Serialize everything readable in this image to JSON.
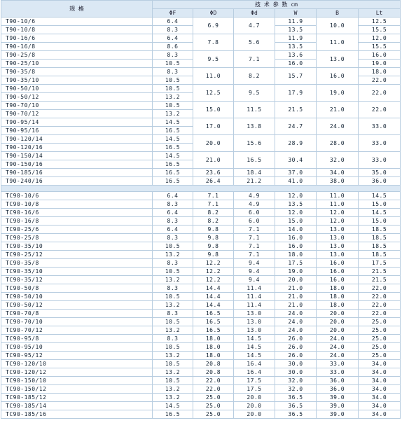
{
  "header": {
    "spec": "规   格",
    "group": "技   术   参   数  cm",
    "cols": [
      "ΦF",
      "ΦD",
      "Φd",
      "W",
      "B",
      "Lt"
    ]
  },
  "rows_t": [
    [
      "T90-10/6",
      "6.4",
      "6.9",
      "4.7",
      "11.9",
      "10.0",
      "12.5"
    ],
    [
      "T90-10/8",
      "8.3",
      null,
      null,
      "13.5",
      null,
      "15.5"
    ],
    [
      "T90-16/6",
      "6.4",
      "7.8",
      "5.6",
      "11.9",
      "11.0",
      "12.0"
    ],
    [
      "T90-16/8",
      "8.6",
      null,
      null,
      "13.5",
      null,
      "15.5"
    ],
    [
      "T90-25/8",
      "8.3",
      "9.5",
      "7.1",
      "13.6",
      "13.0",
      "16.0"
    ],
    [
      "T90-25/10",
      "10.5",
      null,
      null,
      "16.0",
      null,
      "19.0"
    ],
    [
      "T90-35/8",
      "8.3",
      "11.0",
      "8.2",
      "15.7",
      "16.0",
      "18.0"
    ],
    [
      "T90-35/10",
      "10.5",
      null,
      null,
      null,
      null,
      "22.0"
    ],
    [
      "T90-50/10",
      "10.5",
      "12.5",
      "9.5",
      "17.9",
      "19.0",
      "22.0"
    ],
    [
      "T90-50/12",
      "13.2",
      null,
      null,
      null,
      null,
      null
    ],
    [
      "T90-70/10",
      "10.5",
      "15.0",
      "11.5",
      "21.5",
      "21.0",
      "22.0"
    ],
    [
      "T90-70/12",
      "13.2",
      null,
      null,
      null,
      null,
      null
    ],
    [
      "T90-95/14",
      "14.5",
      "17.0",
      "13.8",
      "24.7",
      "24.0",
      "33.0"
    ],
    [
      "T90-95/16",
      "16.5",
      null,
      null,
      null,
      null,
      null
    ],
    [
      "T90-120/14",
      "14.5",
      "20.0",
      "15.6",
      "28.9",
      "28.0",
      "33.0"
    ],
    [
      "T90-120/16",
      "16.5",
      null,
      null,
      null,
      null,
      null
    ],
    [
      "T90-150/14",
      "14.5",
      "21.0",
      "16.5",
      "30.4",
      "32.0",
      "33.0"
    ],
    [
      "T90-150/16",
      "16.5",
      null,
      null,
      null,
      null,
      null
    ],
    [
      "T90-185/16",
      "16.5",
      "23.6",
      "18.4",
      "37.0",
      "34.0",
      "35.0"
    ],
    [
      "T90-240/16",
      "16.5",
      "26.4",
      "21.2",
      "41.0",
      "38.0",
      "36.0"
    ]
  ],
  "rows_tc": [
    [
      "TC90-10/6",
      "6.4",
      "7.1",
      "4.9",
      "12.0",
      "11.0",
      "14.5"
    ],
    [
      "TC90-10/8",
      "8.3",
      "7.1",
      "4.9",
      "13.5",
      "11.0",
      "15.0"
    ],
    [
      "TC90-16/6",
      "6.4",
      "8.2",
      "6.0",
      "12.0",
      "12.0",
      "14.5"
    ],
    [
      "TC90-16/8",
      "8.3",
      "8.2",
      "6.0",
      "15.0",
      "12.0",
      "15.0"
    ],
    [
      "TC90-25/6",
      "6.4",
      "9.8",
      "7.1",
      "14.0",
      "13.0",
      "18.5"
    ],
    [
      "TC90-25/8",
      "8.3",
      "9.8",
      "7.1",
      "16.0",
      "13.0",
      "18.5"
    ],
    [
      "TC90-35/10",
      "10.5",
      "9.8",
      "7.1",
      "16.0",
      "13.0",
      "18.5"
    ],
    [
      "TC90-25/12",
      "13.2",
      "9.8",
      "7.1",
      "18.0",
      "13.0",
      "18.5"
    ],
    [
      "TC90-35/8",
      "8.3",
      "12.2",
      "9.4",
      "17.5",
      "16.0",
      "17.5"
    ],
    [
      "TC90-35/10",
      "10.5",
      "12.2",
      "9.4",
      "19.0",
      "16.0",
      "21.5"
    ],
    [
      "TC90-35/12",
      "13.2",
      "12.2",
      "9.4",
      "20.0",
      "16.0",
      "21.5"
    ],
    [
      "TC90-50/8",
      "8.3",
      "14.4",
      "11.4",
      "21.0",
      "18.0",
      "22.0"
    ],
    [
      "TC90-50/10",
      "10.5",
      "14.4",
      "11.4",
      "21.0",
      "18.0",
      "22.0"
    ],
    [
      "TC90-50/12",
      "13.2",
      "14.4",
      "11.4",
      "21.0",
      "18.0",
      "22.0"
    ],
    [
      "TC90-70/8",
      "8.3",
      "16.5",
      "13.0",
      "24.0",
      "20.0",
      "22.0"
    ],
    [
      "TC90-70/10",
      "10.5",
      "16.5",
      "13.0",
      "24.0",
      "20.0",
      "25.0"
    ],
    [
      "TC90-70/12",
      "13.2",
      "16.5",
      "13.0",
      "24.0",
      "20.0",
      "25.0"
    ],
    [
      "TC90-95/8",
      "8.3",
      "18.0",
      "14.5",
      "26.0",
      "24.0",
      "25.0"
    ],
    [
      "TC90-95/10",
      "10.5",
      "18.0",
      "14.5",
      "26.0",
      "24.0",
      "25.0"
    ],
    [
      "TC90-95/12",
      "13.2",
      "18.0",
      "14.5",
      "26.0",
      "24.0",
      "25.0"
    ],
    [
      "TC90-120/10",
      "10.5",
      "20.8",
      "16.4",
      "30.0",
      "33.0",
      "34.0"
    ],
    [
      "TC90-120/12",
      "13.2",
      "20.8",
      "16.4",
      "30.0",
      "33.0",
      "34.0"
    ],
    [
      "TC90-150/10",
      "10.5",
      "22.0",
      "17.5",
      "32.0",
      "36.0",
      "34.0"
    ],
    [
      "TC90-150/12",
      "13.2",
      "22.0",
      "17.5",
      "32.0",
      "36.0",
      "34.0"
    ],
    [
      "TC90-185/12",
      "13.2",
      "25.0",
      "20.0",
      "36.5",
      "39.0",
      "34.0"
    ],
    [
      "TC90-185/14",
      "14.5",
      "25.0",
      "20.0",
      "36.5",
      "39.0",
      "34.0"
    ],
    [
      "TC90-185/16",
      "16.5",
      "25.0",
      "20.0",
      "36.5",
      "39.0",
      "34.0"
    ]
  ]
}
